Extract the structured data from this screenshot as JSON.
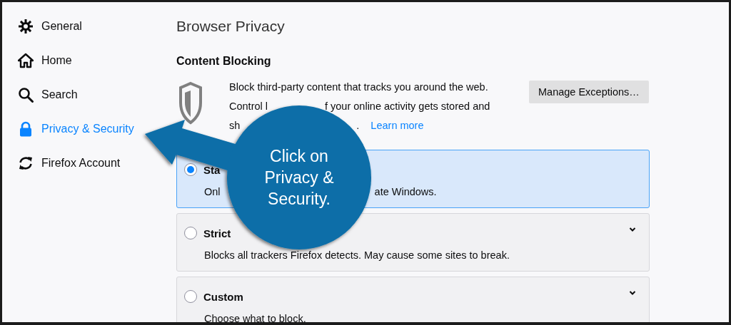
{
  "sidebar": {
    "items": [
      {
        "label": "General",
        "kind": "gear",
        "selected": false
      },
      {
        "label": "Home",
        "kind": "home",
        "selected": false
      },
      {
        "label": "Search",
        "kind": "search",
        "selected": false
      },
      {
        "label": "Privacy & Security",
        "kind": "lock",
        "selected": true
      },
      {
        "label": "Firefox Account",
        "kind": "sync",
        "selected": false
      }
    ]
  },
  "heading": "Browser Privacy",
  "content_blocking": {
    "title": "Content Blocking",
    "description_lines": [
      [
        "Block third-party content that tracks you around the web."
      ],
      [
        "Control l",
        "f your online activity gets stored and"
      ],
      [
        "sh",
        "."
      ]
    ],
    "link": "Learn more",
    "manage_button": "Manage Exceptions…"
  },
  "options": [
    {
      "title": "Sta",
      "description": [
        "Onl",
        "ate Windows."
      ],
      "selected": true,
      "expandable": false
    },
    {
      "title": "Strict",
      "description": [
        "Blocks all trackers Firefox detects. May cause some sites to break."
      ],
      "selected": false,
      "expandable": true
    },
    {
      "title": "Custom",
      "description": [
        "Choose what to block."
      ],
      "selected": false,
      "expandable": true
    }
  ],
  "callout": {
    "text": "Click on Privacy & Security."
  }
}
